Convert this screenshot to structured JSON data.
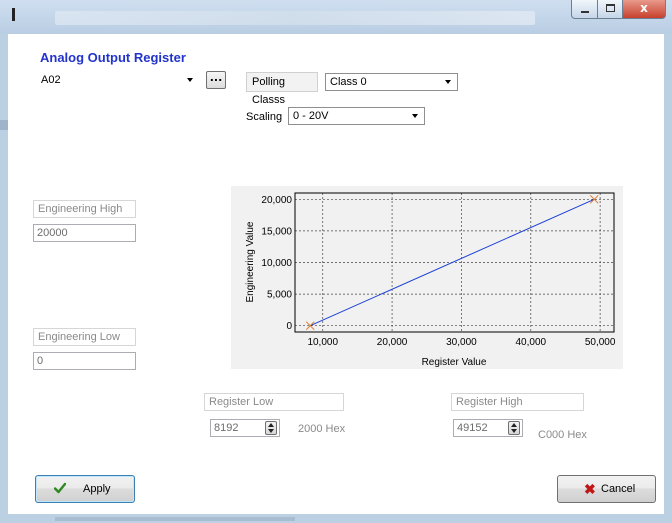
{
  "window": {
    "close_glyph": "x"
  },
  "form": {
    "heading": "Analog Output Register",
    "register": {
      "value": "A02"
    },
    "browse_label": "...",
    "polling_label": "Polling Classs",
    "polling_value": "Class 0",
    "scaling_label": "Scaling",
    "scaling_value": "0 - 20V",
    "eng_high_label": "Engineering High",
    "eng_high_value": "20000",
    "eng_low_label": "Engineering Low",
    "eng_low_value": "0",
    "reg_low_label": "Register Low",
    "reg_low_value": "8192",
    "reg_low_hex": "2000 Hex",
    "reg_high_label": "Register High",
    "reg_high_value": "49152",
    "reg_high_hex": "C000 Hex"
  },
  "buttons": {
    "apply": "Apply",
    "cancel": "Cancel"
  },
  "colors": {
    "heading": "#2233cc",
    "line": "#1a3fd6",
    "endpoint": "#e07a2c",
    "cancel_x": "#c01818",
    "apply_check": "#2c8a1e"
  },
  "chart_data": {
    "type": "line",
    "xlabel": "Register Value",
    "ylabel": "Engineering Value",
    "xlim": [
      6000,
      52000
    ],
    "ylim": [
      -1000,
      21000
    ],
    "xticks": [
      10000,
      20000,
      30000,
      40000,
      50000
    ],
    "xtick_labels": [
      "10,000",
      "20,000",
      "30,000",
      "40,000",
      "50,000"
    ],
    "yticks": [
      0,
      5000,
      10000,
      15000,
      20000
    ],
    "ytick_labels": [
      "0",
      "5,000",
      "10,000",
      "15,000",
      "20,000"
    ],
    "grid": true,
    "series": [
      {
        "x": [
          8192,
          49152
        ],
        "y": [
          0,
          20000
        ]
      }
    ]
  }
}
